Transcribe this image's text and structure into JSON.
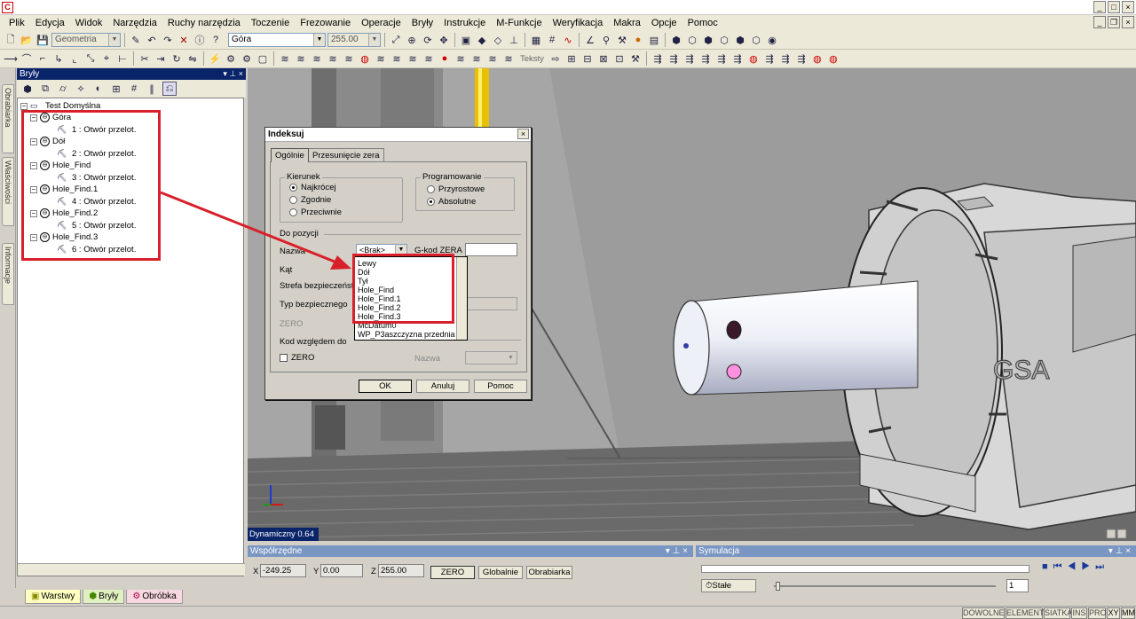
{
  "menu": [
    "Plik",
    "Edycja",
    "Widok",
    "Narzędzia",
    "Ruchy narzędzia",
    "Toczenie",
    "Frezowanie",
    "Operacje",
    "Bryły",
    "Instrukcje",
    "M-Funkcje",
    "Weryfikacja",
    "Makra",
    "Opcje",
    "Pomoc"
  ],
  "toolbar": {
    "geometry_combo": "Geometria",
    "view_combo": "Góra",
    "value_combo": "255.00",
    "teksty_label": "Teksty"
  },
  "left_tabs": [
    "Obrabiarka",
    "Właściwości",
    "Informacje"
  ],
  "panel": {
    "title": "Bryły"
  },
  "tree": {
    "root": "Test Domyślna",
    "nodes": [
      {
        "label": "Góra",
        "child": "1 : Otwór przelot."
      },
      {
        "label": "Dół",
        "child": "2 : Otwór przelot."
      },
      {
        "label": "Hole_Find",
        "child": "3 : Otwór przelot."
      },
      {
        "label": "Hole_Find.1",
        "child": "4 : Otwór przelot."
      },
      {
        "label": "Hole_Find.2",
        "child": "5 : Otwór przelot."
      },
      {
        "label": "Hole_Find.3",
        "child": "6 : Otwór przelot."
      }
    ]
  },
  "bottom_tabs": [
    "Warstwy",
    "Bryły",
    "Obróbka"
  ],
  "dialog": {
    "title": "Indeksuj",
    "tabs": [
      "Ogólnie",
      "Przesunięcie zera"
    ],
    "kierunek_label": "Kierunek",
    "kierunek_options": [
      "Najkrócej",
      "Zgodnie",
      "Przeciwnie"
    ],
    "programowanie_label": "Programowanie",
    "programowanie_options": [
      "Przyrostowe",
      "Absolutne"
    ],
    "do_pozycji": "Do pozycji",
    "nazwa_label": "Nazwa",
    "nazwa_value": "<Brak>",
    "gkod_label": "G-kod ZERA",
    "kat_label": "Kąt",
    "strefa_label": "Strefa bezpieczeństwa",
    "typ_label": "Typ bezpiecznego",
    "zero_label": "ZERO",
    "kod_label": "Kod względem do",
    "zero_check": "ZERO",
    "nazwa2_label": "Nazwa",
    "ok": "OK",
    "cancel": "Anuluj",
    "help": "Pomoc"
  },
  "dropdown_items": [
    "Lewy",
    "Dół",
    "Tył",
    "Hole_Find",
    "Hole_Find.1",
    "Hole_Find.2",
    "Hole_Find.3",
    "McDatum0",
    "WP_P3aszczyzna przednia"
  ],
  "viewport": {
    "status": "Dynamiczny 0.64",
    "logo_text": "GSA"
  },
  "coords": {
    "title": "Współrzędne",
    "x_label": "X",
    "x": "-249.25",
    "y_label": "Y",
    "y": "0.00",
    "z_label": "Z",
    "z": "255.00",
    "zero_btn": "ZERO",
    "global_btn": "Globalnie",
    "machine_btn": "Obrabiarka"
  },
  "sim": {
    "title": "Symulacja",
    "stale": "Stałe",
    "count": "1"
  },
  "statusbar": [
    "DOWOLNE",
    "ELEMENT",
    "SIATKA",
    "INS",
    "PRO",
    "XY",
    "MM"
  ]
}
